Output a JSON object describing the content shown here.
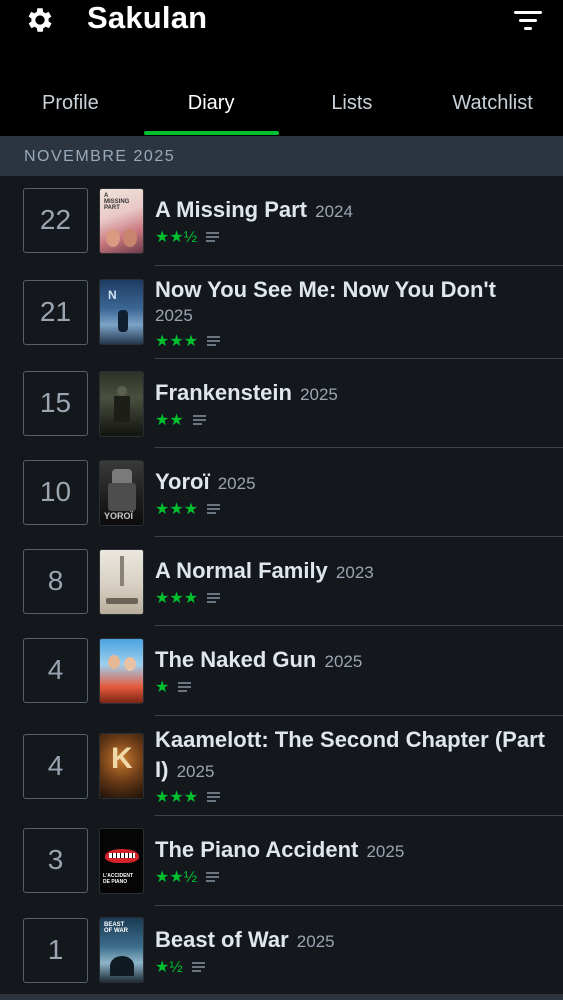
{
  "app": {
    "title": "Sakulan"
  },
  "tabs": [
    {
      "label": "Profile",
      "active": false
    },
    {
      "label": "Diary",
      "active": true
    },
    {
      "label": "Lists",
      "active": false
    },
    {
      "label": "Watchlist",
      "active": false
    }
  ],
  "section": {
    "month": "NOVEMBRE 2025"
  },
  "colors": {
    "accent": "#00c030",
    "background": "#14181c",
    "header": "#2c3440"
  },
  "entries": [
    {
      "day": "22",
      "title": "A Missing Part",
      "year": "2024",
      "stars": "★★½",
      "rating": 2.5,
      "has_review": true,
      "poster_icon": "poster-a-missing-part"
    },
    {
      "day": "21",
      "title": "Now You See Me: Now You Don't",
      "year": "2025",
      "stars": "★★★",
      "rating": 3,
      "has_review": true,
      "poster_icon": "poster-now-you-see-me"
    },
    {
      "day": "15",
      "title": "Frankenstein",
      "year": "2025",
      "stars": "★★",
      "rating": 2,
      "has_review": true,
      "poster_icon": "poster-frankenstein"
    },
    {
      "day": "10",
      "title": "Yoroï",
      "year": "2025",
      "stars": "★★★",
      "rating": 3,
      "has_review": true,
      "poster_icon": "poster-yoroi"
    },
    {
      "day": "8",
      "title": "A Normal Family",
      "year": "2023",
      "stars": "★★★",
      "rating": 3,
      "has_review": true,
      "poster_icon": "poster-a-normal-family"
    },
    {
      "day": "4",
      "title": "The Naked Gun",
      "year": "2025",
      "stars": "★",
      "rating": 1,
      "has_review": true,
      "poster_icon": "poster-the-naked-gun"
    },
    {
      "day": "4",
      "title": "Kaamelott: The Second Chapter (Part I)",
      "year": "2025",
      "stars": "★★★",
      "rating": 3,
      "has_review": true,
      "poster_icon": "poster-kaamelott"
    },
    {
      "day": "3",
      "title": "The Piano Accident",
      "year": "2025",
      "stars": "★★½",
      "rating": 2.5,
      "has_review": true,
      "poster_icon": "poster-the-piano-accident"
    },
    {
      "day": "1",
      "title": "Beast of War",
      "year": "2025",
      "stars": "★½",
      "rating": 1.5,
      "has_review": true,
      "poster_icon": "poster-beast-of-war"
    }
  ]
}
